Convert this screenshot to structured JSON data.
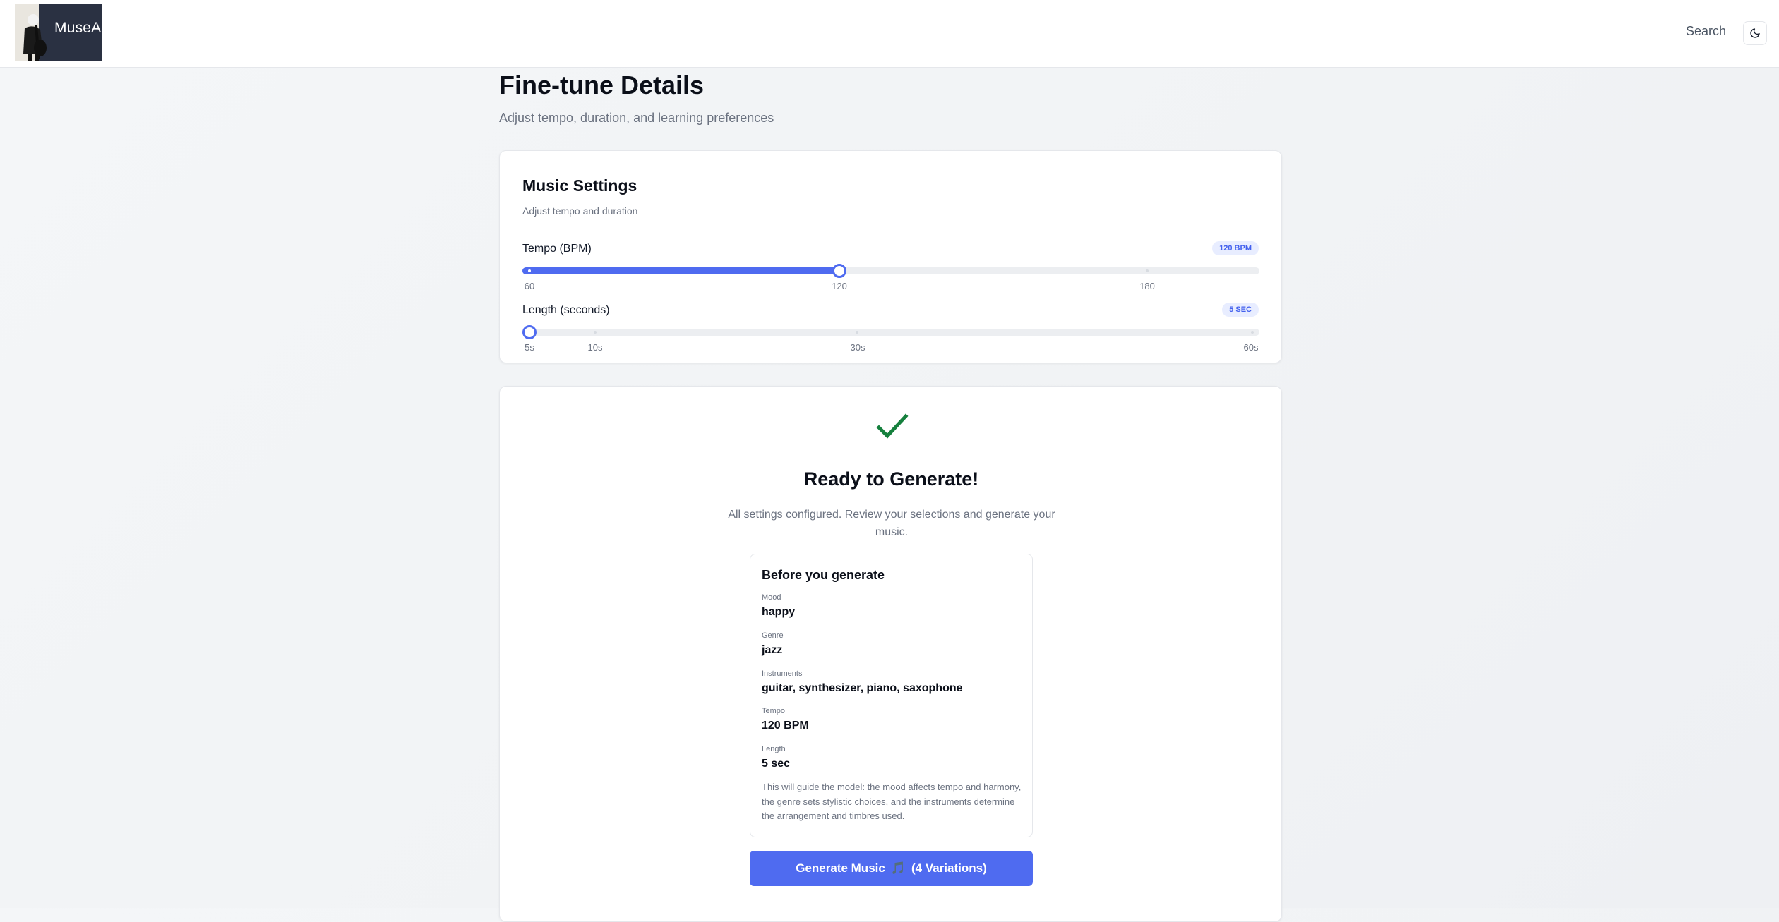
{
  "header": {
    "logo_text": "MuseAI",
    "search_label": "Search",
    "theme_icon": "moon-icon"
  },
  "page": {
    "title": "Fine-tune Details",
    "subtitle": "Adjust tempo, duration, and learning preferences"
  },
  "settings": {
    "title": "Music Settings",
    "subtitle": "Adjust tempo and duration",
    "tempo": {
      "label": "Tempo (BPM)",
      "badge": "120 BPM",
      "min": 60,
      "max": 180,
      "value": 120,
      "ticks": [
        "60",
        "120",
        "180"
      ]
    },
    "length": {
      "label": "Length (seconds)",
      "badge": "5 SEC",
      "value": 5,
      "ticks": [
        "5s",
        "10s",
        "30s",
        "60s"
      ]
    }
  },
  "ready": {
    "icon": "check-icon",
    "title": "Ready to Generate!",
    "description": "All settings configured. Review your selections and generate your music.",
    "summary": {
      "title": "Before you generate",
      "items": [
        {
          "key": "Mood",
          "value": "happy"
        },
        {
          "key": "Genre",
          "value": "jazz"
        },
        {
          "key": "Instruments",
          "value": "guitar, synthesizer, piano, saxophone"
        },
        {
          "key": "Tempo",
          "value": "120 BPM"
        },
        {
          "key": "Length",
          "value": "5 sec"
        }
      ],
      "note": "This will guide the model: the mood affects tempo and harmony, the genre sets stylistic choices, and the instruments determine the arrangement and timbres used."
    },
    "button": {
      "label_before": "Generate Music",
      "glyph": "🎵",
      "label_after": "(4 Variations)"
    }
  },
  "colors": {
    "accent": "#4f6bf0",
    "success": "#16a34a",
    "badge_bg": "#e8edff"
  }
}
